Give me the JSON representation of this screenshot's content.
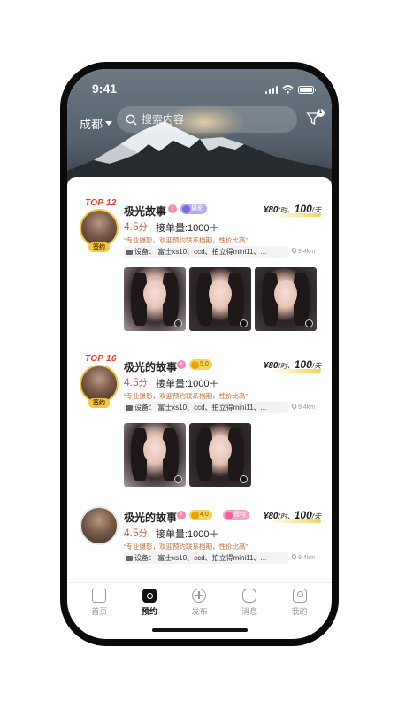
{
  "status": {
    "time": "9:41"
  },
  "header": {
    "city": "成都",
    "search_placeholder": "搜索内容",
    "filter_badge": "1"
  },
  "cards": [
    {
      "rank": "TOP 12",
      "name": "极光故事",
      "gender_symbol": "♀",
      "tags": [
        {
          "label": "摄影",
          "color": "purple"
        }
      ],
      "signed_label": "签约",
      "price_hour": "¥80",
      "price_hour_unit": "/时、",
      "price_day": "100",
      "price_day_unit": "/天",
      "score": "4.5",
      "score_unit": "分",
      "orders": "接单量:1000＋",
      "quote": "“专业摄影，欢迎预约联系档期，性价比高”",
      "device": "设备：  富士xs10、ccd、拍立得mini11、...",
      "distance": "9.4km",
      "photo_count": 3
    },
    {
      "rank": "TOP 16",
      "name": "极光的故事",
      "gender_symbol": "♀",
      "tags": [
        {
          "label": "5.0",
          "color": "gold"
        }
      ],
      "signed_label": "签约",
      "price_hour": "¥80",
      "price_hour_unit": "/时、",
      "price_day": "100",
      "price_day_unit": "/天",
      "score": "4.5",
      "score_unit": "分",
      "orders": "接单量:1000＋",
      "quote": "“专业摄影，欢迎预约联系档期，性价比高”",
      "device": "设备：  富士xs10、ccd、拍立得mini11、...",
      "distance": "9.4km",
      "photo_count": 2
    },
    {
      "rank": "",
      "name": "极光的故事",
      "gender_symbol": "♀",
      "tags": [
        {
          "label": "4.0",
          "color": "gold"
        },
        {
          "label": "模特",
          "color": "pink"
        }
      ],
      "signed_label": "",
      "price_hour": "¥80",
      "price_hour_unit": "/时、",
      "price_day": "100",
      "price_day_unit": "/天",
      "score": "4.5",
      "score_unit": "分",
      "orders": "接单量:1000＋",
      "quote": "“专业摄影，欢迎预约联系档期，性价比高”",
      "device": "设备：  富士xs10、ccd、拍立得mini11、...",
      "distance": "9.4km",
      "photo_count": 0
    }
  ],
  "tabs": [
    {
      "label": "首页",
      "icon": "home-icon",
      "active": false
    },
    {
      "label": "预约",
      "icon": "camera-icon",
      "active": true
    },
    {
      "label": "发布",
      "icon": "plus-icon",
      "active": false
    },
    {
      "label": "消息",
      "icon": "message-icon",
      "active": false
    },
    {
      "label": "我的",
      "icon": "profile-icon",
      "active": false
    }
  ]
}
